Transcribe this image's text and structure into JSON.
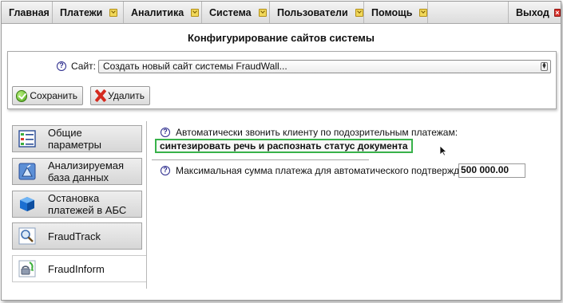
{
  "menu": {
    "items": [
      {
        "label": "Главная"
      },
      {
        "label": "Платежи"
      },
      {
        "label": "Аналитика"
      },
      {
        "label": "Система"
      },
      {
        "label": "Пользователи"
      },
      {
        "label": "Помощь"
      }
    ],
    "exit_label": "Выход"
  },
  "page": {
    "title": "Конфигурирование сайтов системы"
  },
  "site": {
    "label": "Сайт:",
    "selected": "Создать новый сайт системы FraudWall..."
  },
  "toolbar": {
    "save_label": "Сохранить",
    "delete_label": "Удалить"
  },
  "nav": {
    "items": [
      {
        "label": "Общие\nпараметры",
        "icon": "checklist-icon"
      },
      {
        "label": "Анализируемая\nбаза данных",
        "icon": "satellite-dish-icon"
      },
      {
        "label": "Остановка\nплатежей в АБС",
        "icon": "blue-cube-icon"
      },
      {
        "label": "FraudTrack",
        "icon": "magnifier-icon"
      },
      {
        "label": "FraudInform",
        "icon": "phone-call-icon"
      }
    ],
    "active_index": 4
  },
  "form": {
    "auto_call_label": "Автоматически звонить клиенту по подозрительным платежам:",
    "auto_call_value": "синтезировать речь и распознать статус документа",
    "max_amount_label": "Максимальная сумма платежа для автоматического подтверждения:",
    "max_amount_value": "500 000.00"
  },
  "colors": {
    "accent_green": "#38b24a",
    "help_icon": "#2a2a8c",
    "exit_red": "#d9312b",
    "menu_chevron": "#f1d85a"
  }
}
